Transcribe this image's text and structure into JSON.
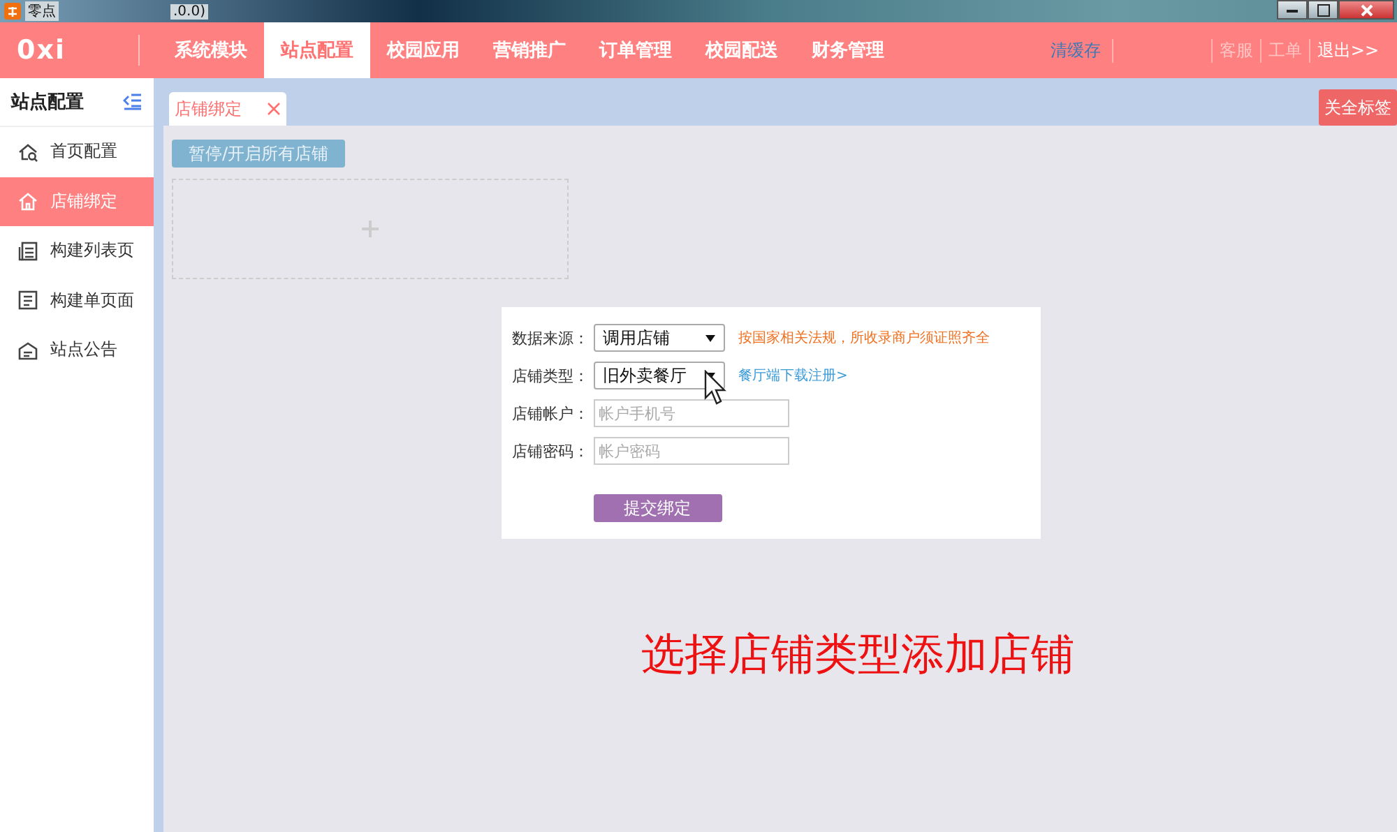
{
  "window": {
    "title": "零点",
    "title_suffix": ".0.0)"
  },
  "nav": {
    "logo": "0xi",
    "items": [
      {
        "label": "系统模块",
        "selected": false
      },
      {
        "label": "站点配置",
        "selected": true
      },
      {
        "label": "校园应用",
        "selected": false
      },
      {
        "label": "营销推广",
        "selected": false
      },
      {
        "label": "订单管理",
        "selected": false
      },
      {
        "label": "校园配送",
        "selected": false
      },
      {
        "label": "财务管理",
        "selected": false
      }
    ],
    "links": [
      {
        "label": "清缓存",
        "kind": "action"
      },
      {
        "label": "客服",
        "kind": "muted"
      },
      {
        "label": "工单",
        "kind": "muted"
      },
      {
        "label": "退出>>",
        "kind": "plain"
      }
    ]
  },
  "sidebar": {
    "title": "站点配置",
    "items": [
      {
        "label": "首页配置",
        "selected": false
      },
      {
        "label": "店铺绑定",
        "selected": true
      },
      {
        "label": "构建列表页",
        "selected": false
      },
      {
        "label": "构建单页面",
        "selected": false
      },
      {
        "label": "站点公告",
        "selected": false
      }
    ]
  },
  "tabs": [
    {
      "label": "店铺绑定",
      "selected": true
    }
  ],
  "close_all": "关全标签",
  "toolbar_button": "暂停/开启所有店铺",
  "form": {
    "fields": [
      {
        "kind": "select",
        "label": "数据来源：",
        "value": "调用店铺",
        "note": "按国家相关法规，所收录商户须证照齐全"
      },
      {
        "kind": "select",
        "label": "店铺类型：",
        "value": "旧外卖餐厅",
        "link": "餐厅端下载注册>"
      },
      {
        "kind": "input",
        "label": "店铺帐户：",
        "placeholder": "帐户手机号"
      },
      {
        "kind": "input",
        "label": "店铺密码：",
        "placeholder": "帐户密码"
      }
    ],
    "submit": "提交绑定"
  },
  "annotation": "选择店铺类型添加店铺"
}
